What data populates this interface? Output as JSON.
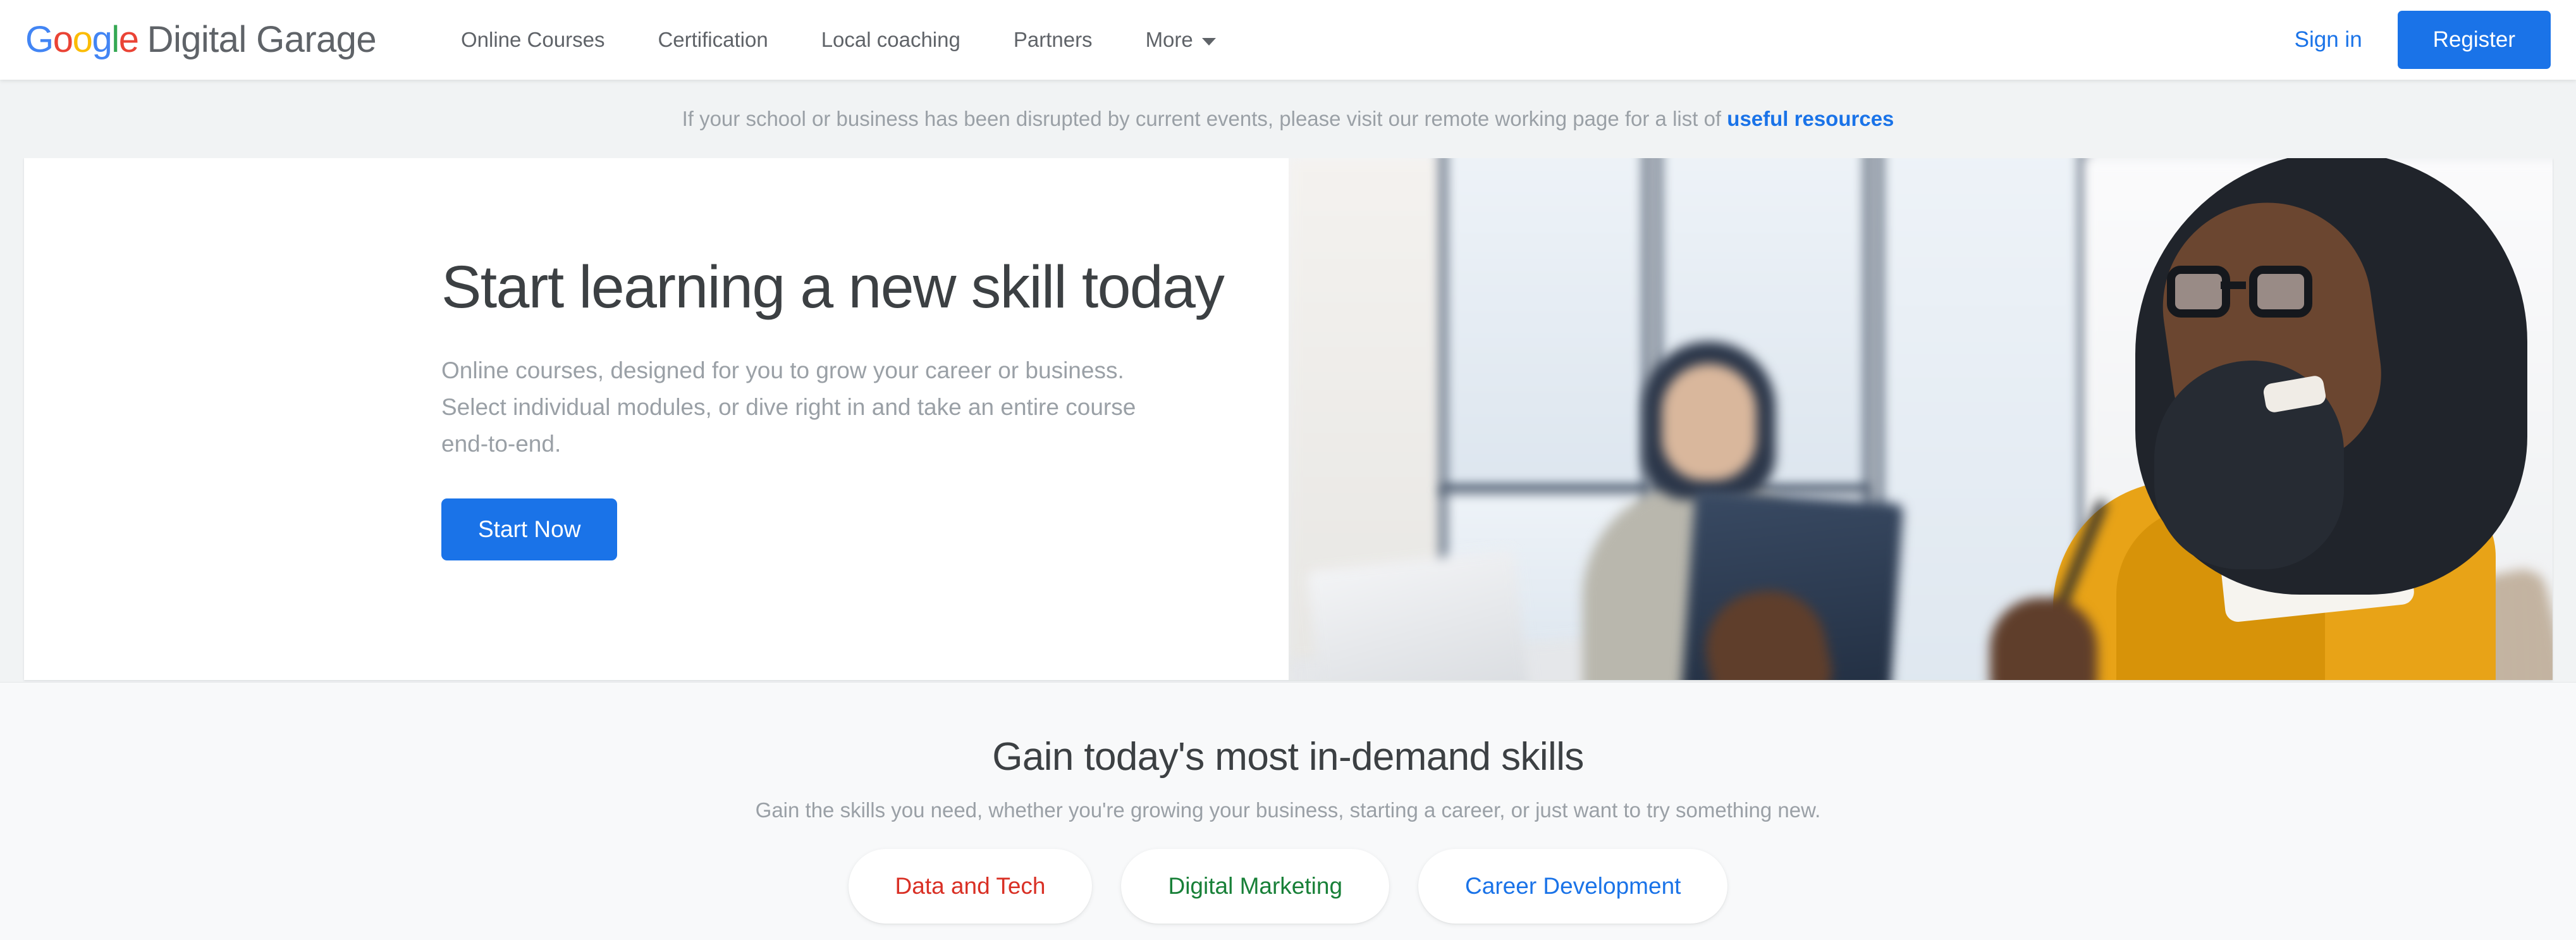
{
  "header": {
    "logo": {
      "google_letters": [
        {
          "char": "G",
          "color": "#4285F4"
        },
        {
          "char": "o",
          "color": "#EA4335"
        },
        {
          "char": "o",
          "color": "#FBBC05"
        },
        {
          "char": "g",
          "color": "#4285F4"
        },
        {
          "char": "l",
          "color": "#34A853"
        },
        {
          "char": "e",
          "color": "#EA4335"
        }
      ],
      "suffix": "Digital Garage"
    },
    "nav_items": [
      {
        "label": "Online Courses",
        "has_caret": false
      },
      {
        "label": "Certification",
        "has_caret": false
      },
      {
        "label": "Local coaching",
        "has_caret": false
      },
      {
        "label": "Partners",
        "has_caret": false
      },
      {
        "label": "More",
        "has_caret": true
      }
    ],
    "sign_in_label": "Sign in",
    "register_label": "Register"
  },
  "banner": {
    "text": "If your school or business has been disrupted by current events, please visit our remote working page for a list of ",
    "link_text": "useful resources"
  },
  "hero": {
    "title": "Start learning a new skill today",
    "subtitle": "Online courses, designed for you to grow your career or business. Select individual modules, or dive right in and take an entire course end-to-end.",
    "cta_label": "Start Now",
    "image_alt": "Two women in a bright office; one in a yellow cardigan with glasses holding a pen, another blurred in the background near a laptop and tablet"
  },
  "skills": {
    "title": "Gain today's most in-demand skills",
    "subtitle": "Gain the skills you need, whether you're growing your business, starting a career, or just want to try something new.",
    "categories": [
      {
        "label": "Data and Tech",
        "color": "#D93025"
      },
      {
        "label": "Digital Marketing",
        "color": "#188038"
      },
      {
        "label": "Career Development",
        "color": "#1A73E8"
      }
    ]
  },
  "colors": {
    "accent_blue": "#1A73E8",
    "page_bg": "#F1F3F4",
    "section_bg": "#F8F9FA",
    "card_bg": "#FFFFFF",
    "text_primary": "#3C4043",
    "text_muted": "#9AA0A6",
    "nav_text": "#5F6368"
  }
}
